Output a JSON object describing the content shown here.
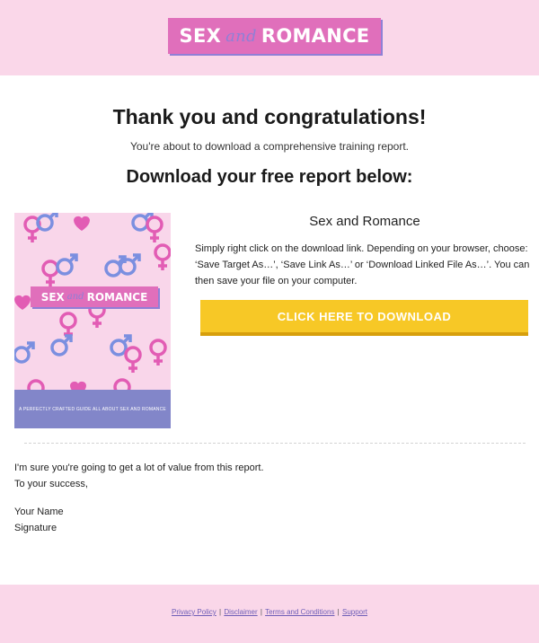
{
  "header": {
    "logo": {
      "word1": "SEX",
      "word2": "and",
      "word3": "ROMANCE"
    }
  },
  "main": {
    "heading": "Thank you and congratulations!",
    "subheading": "You're about to download a comprehensive training report.",
    "download_heading": "Download your free report below:",
    "cover": {
      "title_word1": "SEX",
      "title_word2": "and",
      "title_word3": "ROMANCE",
      "tagline": "A PERFECTLY CRAFTED GUIDE ALL ABOUT SEX AND ROMANCE"
    },
    "product_title": "Sex and Romance",
    "instructions": "Simply right click on the download link. Depending on your browser, choose: ‘Save Target As…’, ‘Save Link As…’ or ‘Download Linked File As…’. You can then save your file on your computer.",
    "download_button": "CLICK HERE TO DOWNLOAD"
  },
  "closing": {
    "line1": "I'm sure you're going to get a lot of value from this report.",
    "line2": "To your success,",
    "name": "Your Name",
    "signature": "Signature"
  },
  "footer": {
    "links": [
      "Privacy Policy",
      "Disclaimer",
      "Terms and Conditions",
      "Support"
    ],
    "separator": "|"
  },
  "colors": {
    "header_bg": "#fad7e9",
    "logo_pink": "#e06fbb",
    "logo_purple": "#8f7fd6",
    "button_yellow": "#f7c826",
    "cover_footer": "#8286c9"
  }
}
